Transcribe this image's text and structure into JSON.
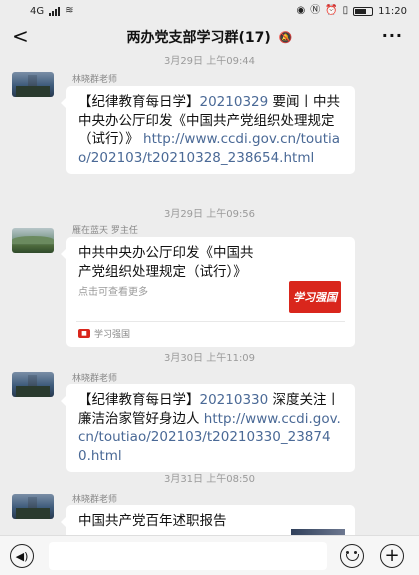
{
  "status_bar": {
    "signal": "4G",
    "icons": [
      "eye-icon",
      "nfc-icon",
      "alarm-icon",
      "vibrate-icon",
      "battery-icon"
    ],
    "time": "11:20"
  },
  "header": {
    "back_symbol": "<",
    "title": "两办党支部学习群(17)",
    "mute_symbol": "🔕",
    "more_symbol": "···"
  },
  "messages": [
    {
      "time": "3月29日 上午09:44",
      "sender": "林晓群老师",
      "text_prefix": "【纪律教育每日学】",
      "text_date": "20210329",
      "text_body": " 要闻丨中共中央办公厅印发《中国共产党组织处理规定（试行）》 ",
      "link": "http://www.ccdi.gov.cn/toutiao/202103/t20210328_238654.html"
    },
    {
      "time": "3月29日 上午09:56",
      "sender": "雁在蓝天 罗主任",
      "card_title": "中共中央办公厅印发《中国共产党组织处理规定（试行）》",
      "card_desc": "点击可查看更多",
      "card_thumb_text": "学习强国",
      "card_source": "学习强国"
    },
    {
      "time": "3月30日 上午11:09",
      "sender": "林晓群老师",
      "text_prefix": "【纪律教育每日学】",
      "text_date": "20210330",
      "text_body": " 深度关注丨廉洁治家管好身边人 ",
      "link": "http://www.ccdi.gov.cn/toutiao/202103/t20210330_238740.html"
    },
    {
      "time": "3月31日 上午08:50",
      "sender": "林晓群老师",
      "card_title": "中国共产党百年述职报告"
    }
  ],
  "input_bar": {
    "placeholder": ""
  }
}
